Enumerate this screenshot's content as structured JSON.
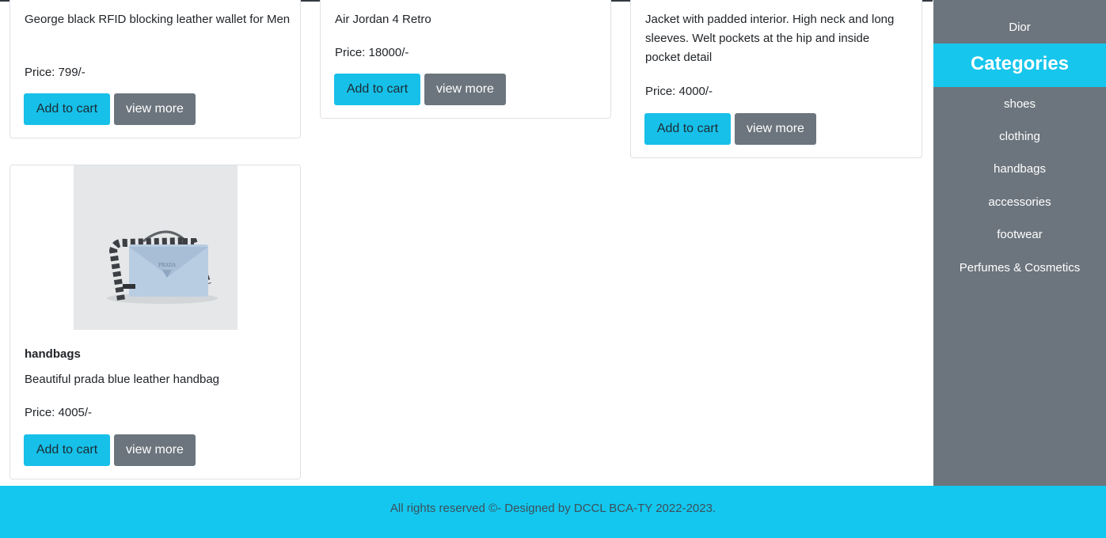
{
  "products": [
    {
      "description": "George black RFID blocking leather wallet for Men",
      "price": "Price: 799/-",
      "add_label": "Add to cart",
      "more_label": "view more"
    },
    {
      "description": "Air Jordan 4 Retro",
      "price": "Price: 18000/-",
      "add_label": "Add to cart",
      "more_label": "view more"
    },
    {
      "description": "Jacket with padded interior. High neck and long sleeves. Welt pockets at the hip and inside pocket detail",
      "price": "Price: 4000/-",
      "add_label": "Add to cart",
      "more_label": "view more"
    },
    {
      "title": "handbags",
      "description": "Beautiful prada blue leather handbag",
      "price": "Price: 4005/-",
      "add_label": "Add to cart",
      "more_label": "view more",
      "image_icon": "prada-handbag-image",
      "logo_text": "PRADA"
    }
  ],
  "sidebar": {
    "top_item": "Dior",
    "heading": "Categories",
    "items": [
      "shoes",
      "clothing",
      "handbags",
      "accessories",
      "footwear",
      "Perfumes & Cosmetics"
    ]
  },
  "footer": {
    "text": "All rights reserved ©- Designed by DCCL BCA-TY 2022-2023."
  },
  "colors": {
    "accent": "#17c0e8",
    "secondary": "#6c757d",
    "footer": "#13c7ee"
  }
}
